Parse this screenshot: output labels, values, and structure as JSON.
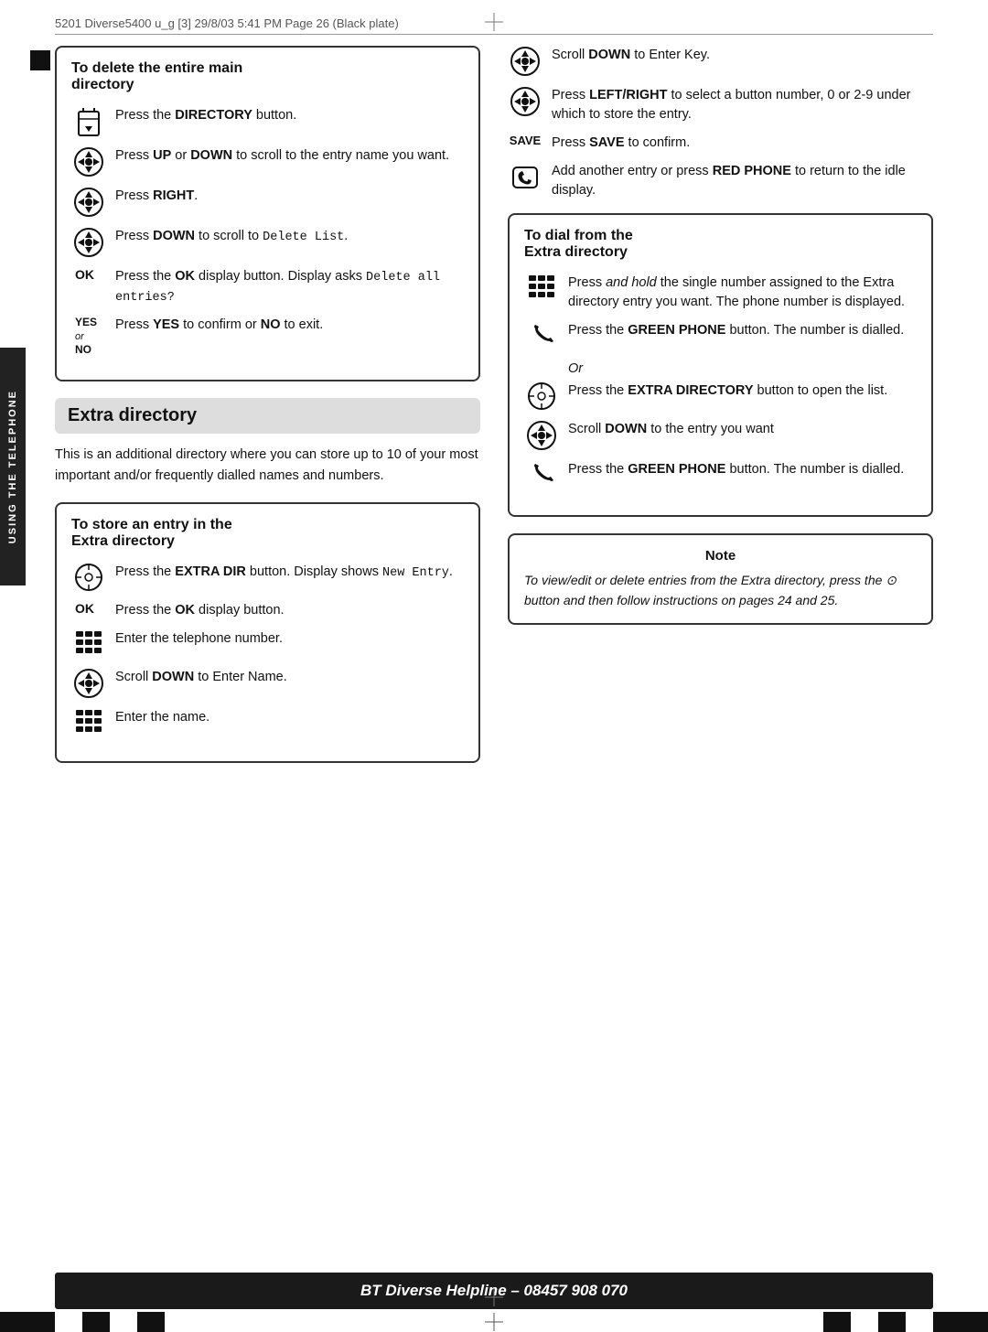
{
  "header": {
    "text": "5201  Diverse5400   u_g [3]  29/8/03  5:41 PM  Page 26     (Black plate)"
  },
  "page_number": "26",
  "side_tab_label": "Using the telephone",
  "helpline": {
    "text": "BT Diverse Helpline – 08457 908 070"
  },
  "left_column": {
    "delete_main_box": {
      "title": "To delete the entire main directory",
      "steps": [
        {
          "icon": "directory-icon",
          "label": "",
          "text": "Press the <b>DIRECTORY</b> button."
        },
        {
          "icon": "nav-icon",
          "label": "",
          "text": "Press <b>UP</b> or <b>DOWN</b> to scroll to the entry name you want."
        },
        {
          "icon": "nav-icon",
          "label": "",
          "text": "Press <b>RIGHT</b>."
        },
        {
          "icon": "nav-icon",
          "label": "",
          "text": "Press <b>DOWN</b> to scroll to <code>Delete List</code>."
        },
        {
          "icon": "",
          "label": "OK",
          "text": "Press the <b>OK</b> display button. Display asks <code>Delete all entries?</code>"
        },
        {
          "icon": "",
          "label": "YES or NO",
          "text": "Press <b>YES</b> to confirm or <b>NO</b> to exit."
        }
      ]
    },
    "extra_section": {
      "heading": "Extra directory",
      "description": "This is an additional directory where you can store up to 10 of your most important and/or frequently dialled names and numbers."
    },
    "store_entry_box": {
      "title": "To store an entry in the Extra directory",
      "steps": [
        {
          "icon": "extra-dir-icon",
          "label": "",
          "text": "Press the <b>EXTRA DIR</b> button. Display shows <code>New Entry</code>."
        },
        {
          "icon": "",
          "label": "OK",
          "text": "Press the <b>OK</b> display button."
        },
        {
          "icon": "keypad-icon",
          "label": "",
          "text": "Enter the telephone number."
        },
        {
          "icon": "nav-icon",
          "label": "",
          "text": "Scroll <b>DOWN</b> to Enter Name."
        },
        {
          "icon": "keypad-icon",
          "label": "",
          "text": "Enter the name."
        }
      ]
    }
  },
  "right_column": {
    "store_entry_continued": {
      "steps": [
        {
          "icon": "nav-icon",
          "label": "",
          "text": "Scroll <b>DOWN</b> to Enter Key."
        },
        {
          "icon": "nav-icon",
          "label": "",
          "text": "Press <b>LEFT/RIGHT</b> to select a button number, 0 or 2-9 under which to store the entry."
        },
        {
          "icon": "",
          "label": "SAVE",
          "text": "Press <b>SAVE</b> to confirm."
        },
        {
          "icon": "red-phone-icon",
          "label": "",
          "text": "Add another entry or press <b>RED PHONE</b> to return to the idle display."
        }
      ]
    },
    "dial_from_extra_box": {
      "title": "To dial from the Extra directory",
      "steps": [
        {
          "icon": "keypad-icon",
          "label": "",
          "text": "Press <i>and hold</i> the single number assigned to the Extra directory entry you want. The phone number is displayed."
        },
        {
          "icon": "green-phone-icon",
          "label": "",
          "text": "Press the <b>GREEN PHONE</b> button. The number is dialled."
        },
        {
          "or": true
        },
        {
          "icon": "extra-dir-icon",
          "label": "",
          "text": "Press the <b>EXTRA DIRECTORY</b> button to open the list."
        },
        {
          "icon": "nav-icon",
          "label": "",
          "text": "Scroll <b>DOWN</b> to the entry you want"
        },
        {
          "icon": "green-phone-icon",
          "label": "",
          "text": "Press the <b>GREEN PHONE</b> button. The number is dialled."
        }
      ]
    },
    "note_box": {
      "title": "Note",
      "text": "To view/edit or delete entries from the Extra directory, press the ⊙ button and then follow instructions on pages 24 and 25."
    }
  }
}
